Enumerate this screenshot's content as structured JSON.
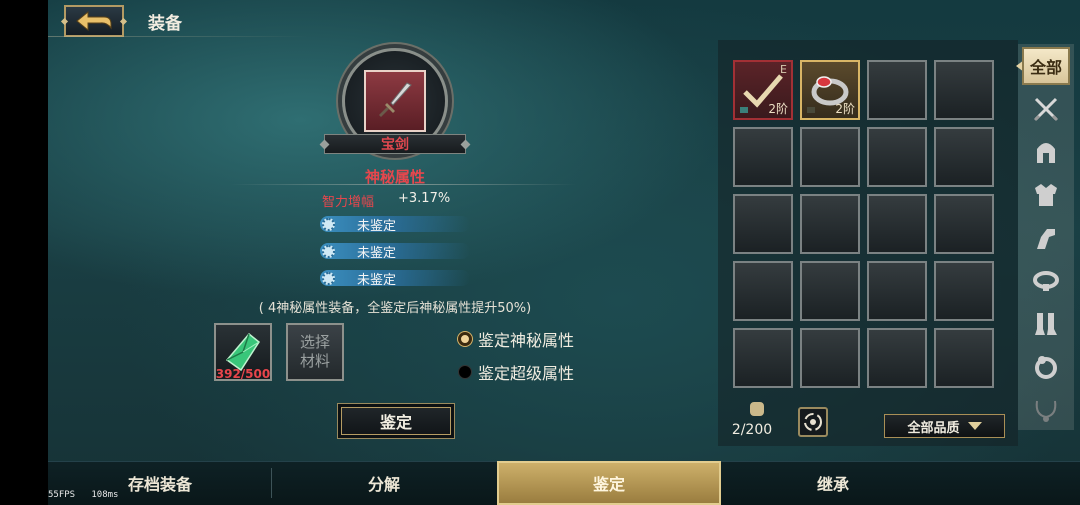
{
  "header": {
    "title": "装备",
    "back_icon": "back-arrow-icon"
  },
  "item": {
    "name": "宝剑",
    "icon": "dagger-icon",
    "section_title": "神秘属性",
    "attribute": {
      "name": "智力增幅",
      "value": "+3.17%"
    },
    "unidentified": [
      "未鉴定",
      "未鉴定",
      "未鉴定"
    ],
    "note": "( 4神秘属性装备，全鉴定后神秘属性提升50%)"
  },
  "materials": {
    "crystal_count": "392/500",
    "select_label": "选择材料"
  },
  "options": [
    {
      "label": "鉴定神秘属性",
      "selected": true
    },
    {
      "label": "鉴定超级属性",
      "selected": false
    }
  ],
  "identify_button": "鉴定",
  "inventory": {
    "slots": [
      {
        "filled": true,
        "rarity": "red",
        "tag": "E",
        "level": "2阶",
        "icon": "check-icon"
      },
      {
        "filled": true,
        "rarity": "gold",
        "tag": "",
        "level": "2阶",
        "icon": "ring-icon"
      }
    ],
    "total_slots": 20,
    "count": "2/200",
    "quality_filter": "全部品质",
    "colors": {
      "red": "#a23035",
      "gold": "#d9b666"
    }
  },
  "side_tabs": [
    {
      "label": "全部",
      "icon": "all-icon",
      "active": true
    },
    {
      "label": "",
      "icon": "crossed-swords-icon"
    },
    {
      "label": "",
      "icon": "helmet-icon"
    },
    {
      "label": "",
      "icon": "armor-icon"
    },
    {
      "label": "",
      "icon": "gauntlet-icon"
    },
    {
      "label": "",
      "icon": "belt-icon"
    },
    {
      "label": "",
      "icon": "boots-icon"
    },
    {
      "label": "",
      "icon": "ring-icon"
    },
    {
      "label": "",
      "icon": "necklace-icon"
    }
  ],
  "bottom_tabs": [
    {
      "label": "存档装备",
      "active": false
    },
    {
      "label": "分解",
      "active": false
    },
    {
      "label": "鉴定",
      "active": true
    },
    {
      "label": "继承",
      "active": false
    }
  ],
  "debug": {
    "fps": "55FPS",
    "ms": "108ms"
  }
}
